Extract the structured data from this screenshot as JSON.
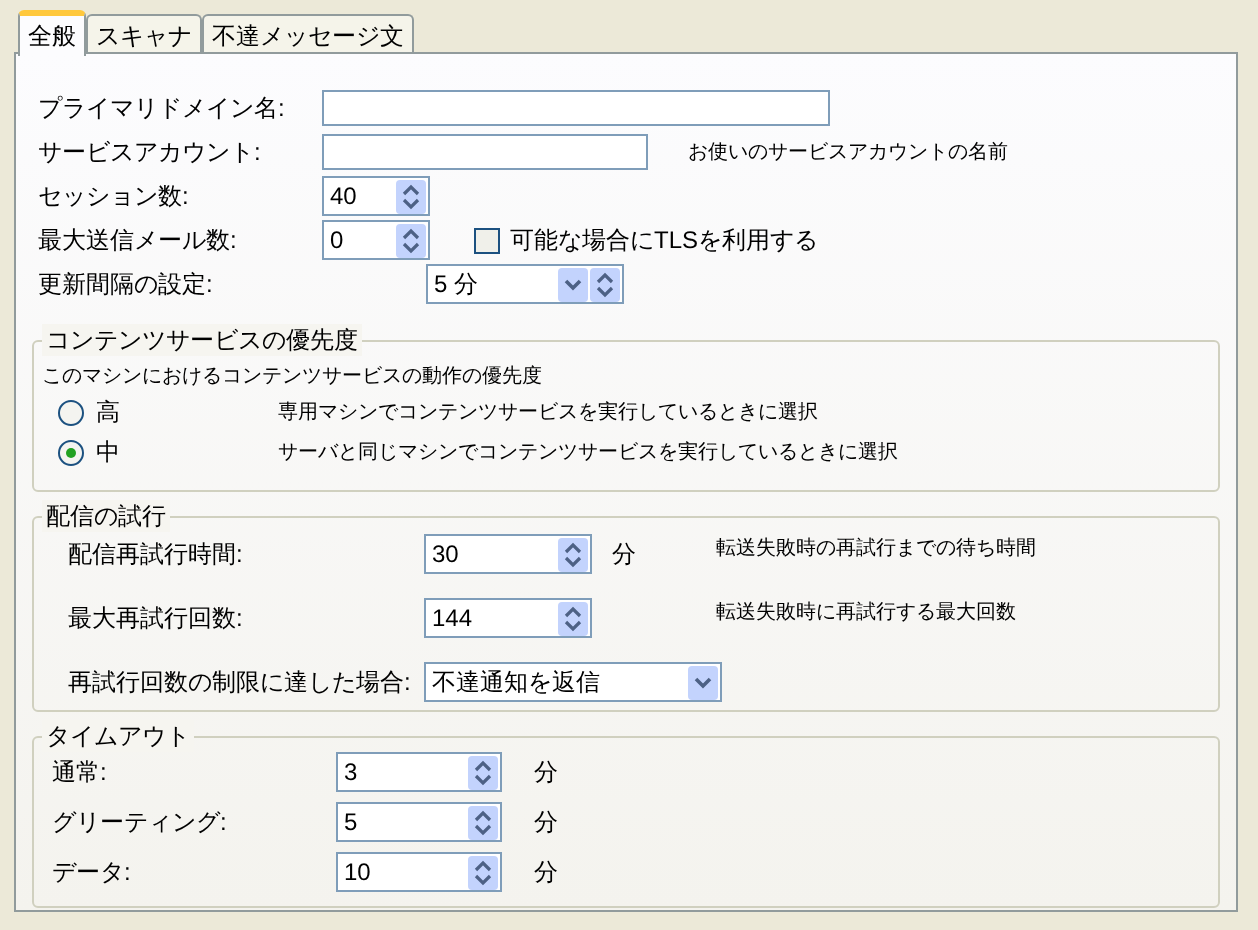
{
  "tabs": [
    {
      "label": "全般",
      "selected": true
    },
    {
      "label": "スキャナ",
      "selected": false
    },
    {
      "label": "不達メッセージ文",
      "selected": false
    }
  ],
  "general": {
    "primary_domain": {
      "label": "プライマリドメイン名:"
    },
    "service_account": {
      "label": "サービスアカウント:",
      "hint": "お使いのサービスアカウントの名前"
    },
    "sessions": {
      "label": "セッション数:",
      "value": "40"
    },
    "max_mail": {
      "label": "最大送信メール数:",
      "value": "0"
    },
    "tls": {
      "label": "可能な場合にTLSを利用する",
      "checked": false
    },
    "update_interval": {
      "label": "更新間隔の設定:",
      "value": "5 分"
    }
  },
  "priority": {
    "title": "コンテンツサービスの優先度",
    "description": "このマシンにおけるコンテンツサービスの動作の優先度",
    "options": [
      {
        "label": "高",
        "hint": "専用マシンでコンテンツサービスを実行しているときに選択",
        "selected": false
      },
      {
        "label": "中",
        "hint": "サーバと同じマシンでコンテンツサービスを実行しているときに選択",
        "selected": true
      }
    ]
  },
  "retry": {
    "title": "配信の試行",
    "rows": [
      {
        "kind": "spin",
        "label": "配信再試行時間:",
        "value": "30",
        "unit": "分",
        "hint": "転送失敗時の再試行までの待ち時間"
      },
      {
        "kind": "spin",
        "label": "最大再試行回数:",
        "value": "144",
        "hint": "転送失敗時に再試行する最大回数"
      },
      {
        "kind": "combo",
        "label": "再試行回数の制限に達した場合:",
        "value": "不達通知を返信"
      }
    ]
  },
  "timeout": {
    "title": "タイムアウト",
    "rows": [
      {
        "label": "通常:",
        "value": "3",
        "unit": "分"
      },
      {
        "label": "グリーティング:",
        "value": "5",
        "unit": "分"
      },
      {
        "label": "データ:",
        "value": "10",
        "unit": "分"
      }
    ]
  }
}
